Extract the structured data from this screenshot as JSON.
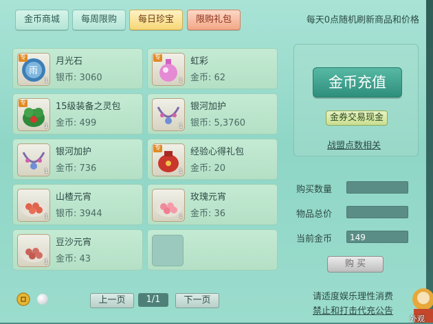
{
  "tabs": [
    {
      "label": "金币商城"
    },
    {
      "label": "每周限购"
    },
    {
      "label": "每日珍宝"
    },
    {
      "label": "限购礼包"
    }
  ],
  "notice": "每天0点随机刷新商品和价格",
  "items": [
    {
      "name": "月光石",
      "price": "银币: 3060",
      "tag": "专",
      "qty": "1",
      "icon": "moonstone-icon"
    },
    {
      "name": "虹彩",
      "price": "金币: 62",
      "tag": "专",
      "qty": "1",
      "icon": "potion-icon"
    },
    {
      "name": "15级装备之灵包",
      "price": "金币: 499",
      "tag": "专",
      "qty": "1",
      "icon": "equipment-bag-icon"
    },
    {
      "name": "银河加护",
      "price": "银币: 5,3760",
      "tag": "",
      "qty": "1",
      "icon": "necklace-icon"
    },
    {
      "name": "银河加护",
      "price": "金币: 736",
      "tag": "",
      "qty": "1",
      "icon": "necklace-icon"
    },
    {
      "name": "经验心得礼包",
      "price": "金币: 20",
      "tag": "专",
      "qty": "1",
      "icon": "gift-pouch-icon"
    },
    {
      "name": "山楂元宵",
      "price": "银币: 3944",
      "tag": "",
      "qty": "1",
      "icon": "dumpling-plate-icon"
    },
    {
      "name": "玫瑰元宵",
      "price": "金币: 36",
      "tag": "",
      "qty": "1",
      "icon": "dumpling-plate-icon"
    },
    {
      "name": "豆沙元宵",
      "price": "金币: 43",
      "tag": "",
      "qty": "1",
      "icon": "dumpling-plate-icon"
    }
  ],
  "right": {
    "recharge": "金币充值",
    "exchange": "金券交易现金",
    "alliance": "战盟点数相关",
    "buy_qty_label": "购买数量",
    "total_label": "物品总价",
    "gold_label": "当前金币",
    "buy_qty": "",
    "total": "",
    "gold": "149",
    "buy_button": "购 买"
  },
  "footer": {
    "warn1": "请适度娱乐理性消费",
    "warn2": "禁止和打击代充公告"
  },
  "pagination": {
    "prev": "上一页",
    "page": "1/1",
    "next": "下一页"
  },
  "side_label": "外观",
  "colors": {
    "accent": "#2f8f7d",
    "active_tab": "#f6d777",
    "red_tab": "#f2a686"
  }
}
